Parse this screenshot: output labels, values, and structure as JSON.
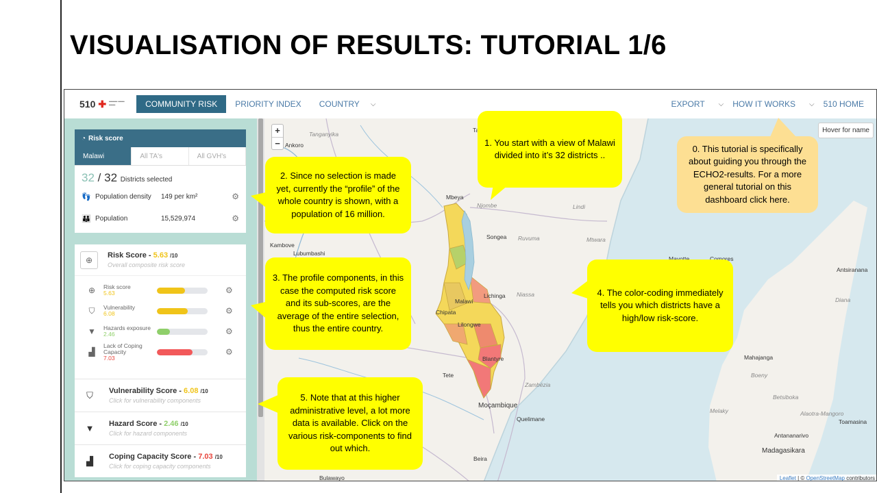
{
  "slide": {
    "title": "VISUALISATION OF RESULTS: TUTORIAL 1/6"
  },
  "nav": {
    "logo_text": "510",
    "items": [
      "COMMUNITY RISK",
      "PRIORITY INDEX",
      "COUNTRY",
      "EXPORT",
      "HOW IT WORKS",
      "510 HOME"
    ]
  },
  "sidebar": {
    "header": "Risk score",
    "tabs": [
      "Malawi",
      "All TA's",
      "All GVH's"
    ],
    "selected_count": "32",
    "total_count": "32",
    "selected_label": "Districts selected",
    "stats": [
      {
        "label": "Population density",
        "value": "149 per km²"
      },
      {
        "label": "Population",
        "value": "15,529,974"
      }
    ],
    "risk_score": {
      "title": "Risk Score",
      "value": "5.63",
      "max": "/10",
      "subtitle": "Overall composite risk score"
    },
    "components": [
      {
        "name": "Risk score",
        "value": "5.63",
        "fill": 0.56,
        "color": "#f0c419"
      },
      {
        "name": "Vulnerability",
        "value": "6.08",
        "fill": 0.61,
        "color": "#f0c419"
      },
      {
        "name": "Hazards exposure",
        "value": "2.46",
        "fill": 0.25,
        "color": "#8fcf6a"
      },
      {
        "name": "Lack of Coping Capacity",
        "value": "7.03",
        "fill": 0.7,
        "color": "#f2595a"
      }
    ],
    "scores": [
      {
        "title": "Vulnerability Score",
        "value": "6.08",
        "max": "/10",
        "subtitle": "Click for vulnerability components"
      },
      {
        "title": "Hazard Score",
        "value": "2.46",
        "max": "/10",
        "subtitle": "Click for hazard components"
      },
      {
        "title": "Coping Capacity Score",
        "value": "7.03",
        "max": "/10",
        "subtitle": "Click for coping capacity components"
      }
    ]
  },
  "map": {
    "zoom_in": "+",
    "zoom_out": "−",
    "hover_label": "Hover for name",
    "attribution_leaflet": "Leaflet",
    "attribution_sep": " | © ",
    "attribution_osm": "OpenStreetMap",
    "attribution_tail": " contributors",
    "places": [
      "Tanganyika",
      "Ankoro",
      "Mbeya",
      "Njombe",
      "Lindi",
      "Songea",
      "Ruvuma",
      "Mtwara",
      "Kambove",
      "Lubumbashi",
      "Lichinga",
      "Niassa",
      "Mayotte",
      "Comores",
      "Antsiranana",
      "Diana",
      "Mahajanga",
      "Boeny",
      "Zambézia",
      "Tete",
      "Moçambique",
      "Quelimane",
      "Betsiboka",
      "Alaotra-Mangoro",
      "Melaky",
      "Toamasina",
      "Antananarivo",
      "Madagasikara",
      "Beira",
      "Bulawayo",
      "Tan",
      "Lilongwe",
      "Chipata",
      "Blantyre",
      "Malawi"
    ]
  },
  "bubbles": {
    "b0": "0. This tutorial is specifically about guiding you through the ECHO2-results. For a more general tutorial on this dashboard click here.",
    "b1": "1. You start with a view of Malawi divided into it’s 32 districts ..",
    "b2": "2. Since no selection is made yet, currently the “profile” of the whole country is shown, with a population of 16 million.",
    "b3": "3. The profile components, in this case the computed risk score and its sub-scores, are the average of the entire selection, thus the entire country.",
    "b4": "4. The color-coding immediately tells you which districts have a high/low risk-score.",
    "b5": "5. Note that at this higher administrative level, a lot more data is available. Click on the various risk-components  to find out which."
  }
}
